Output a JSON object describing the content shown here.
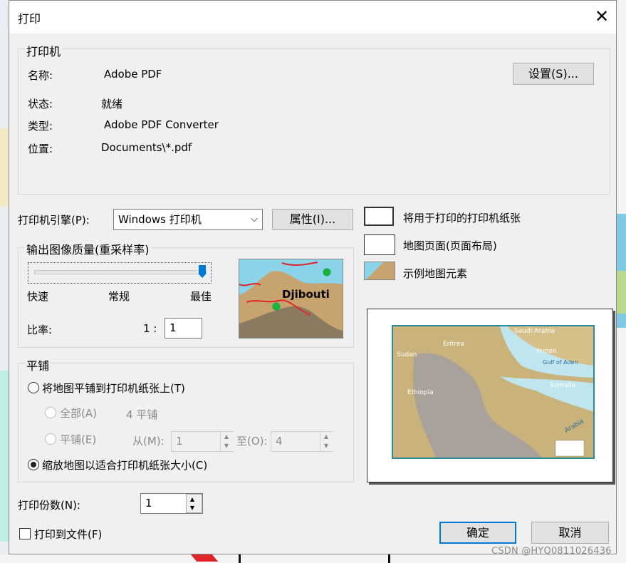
{
  "window": {
    "title": "打印"
  },
  "printer": {
    "group_title": "打印机",
    "name_label": "名称:",
    "name_value": "Adobe PDF",
    "status_label": "状态:",
    "status_value": "就绪",
    "type_label": "类型:",
    "type_value": "Adobe PDF Converter",
    "location_label": "位置:",
    "location_value": "Documents\\*.pdf",
    "setup_button": "设置(S)..."
  },
  "engine": {
    "label": "打印机引擎(P):",
    "selected": "Windows 打印机",
    "properties_button": "属性(I)..."
  },
  "quality": {
    "group_title": "输出图像质量(重采样率)",
    "fast": "快速",
    "normal": "常规",
    "best": "最佳",
    "level": 1.0,
    "ratio_label": "比率:",
    "ratio_prefix": "1 :",
    "ratio_value": "1"
  },
  "preview_map": {
    "label": "Djibouti"
  },
  "legend": {
    "paper": "将用于打印的打印机纸张",
    "page": "地图页面(页面布局)",
    "sample": "示例地图元素"
  },
  "page_preview": {
    "labels": [
      "Saudi Arabia",
      "Eritrea",
      "Yemen",
      "Sudan",
      "Gulf of Aden",
      "Ethiopia",
      "Somalia",
      "Arabia"
    ]
  },
  "tiling": {
    "group_title": "平铺",
    "tile_option": "将地图平铺到打印机纸张上(T)",
    "all_option": "全部(A)",
    "tile_count": "4 平铺",
    "tiles_option": "平铺(E)",
    "from_label": "从(M):",
    "from_value": "1",
    "to_label": "至(O):",
    "to_value": "4",
    "scale_option": "缩放地图以适合打印机纸张大小(C)"
  },
  "copies": {
    "label": "打印份数(N):",
    "value": "1"
  },
  "print_to_file": "打印到文件(F)",
  "ok_button": "确定",
  "cancel_button": "取消",
  "watermark": "CSDN @HYQ0811026436"
}
